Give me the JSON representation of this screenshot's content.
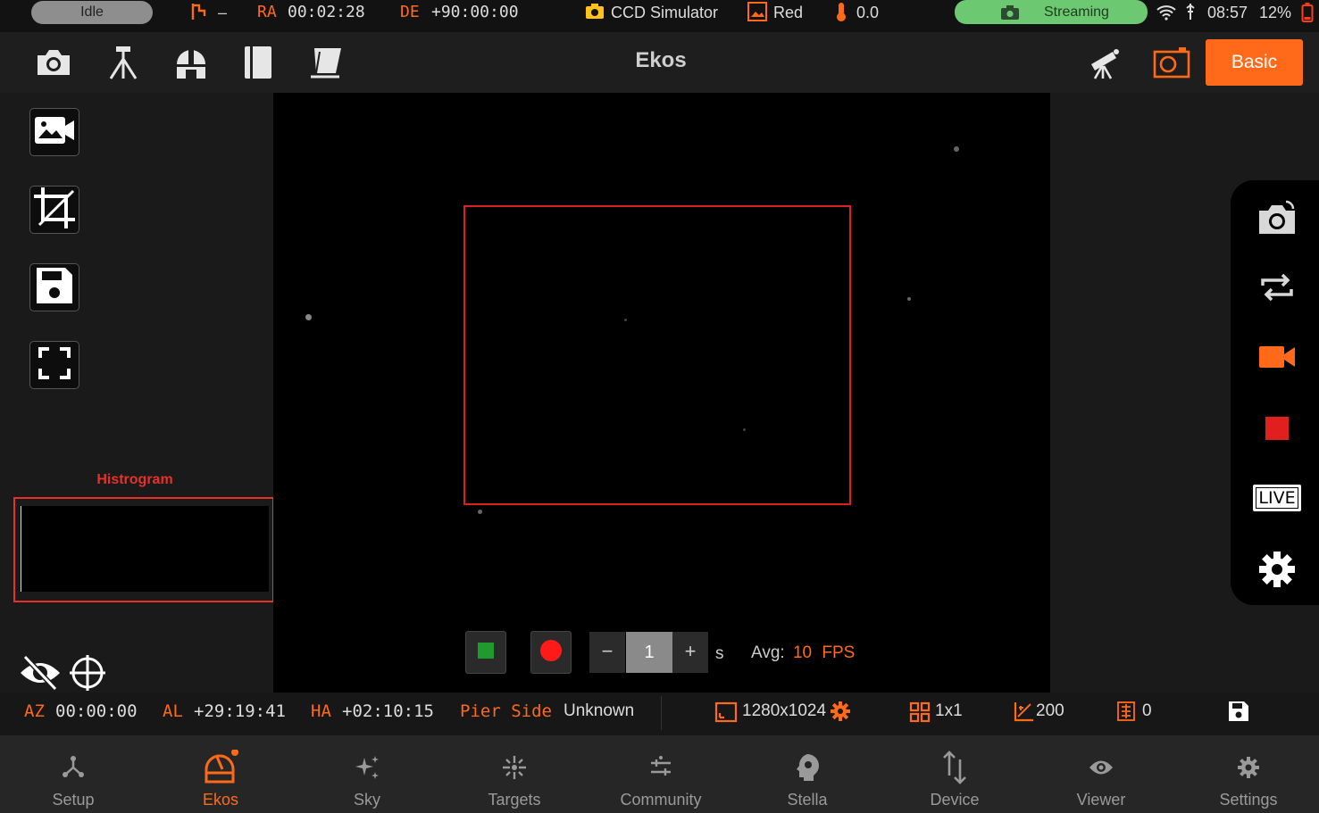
{
  "status_bar": {
    "state": "Idle",
    "mount_icon": "mount-icon",
    "mount_dash": "–",
    "ra_label": "RA",
    "ra_value": "00:02:28",
    "de_label": "DE",
    "de_value": "+90:00:00",
    "camera_name": "CCD Simulator",
    "filter_name": "Red",
    "temperature": "0.0",
    "streaming_label": "Streaming",
    "time": "08:57",
    "battery": "12%"
  },
  "toolbar": {
    "title": "Ekos",
    "basic_button": "Basic",
    "icons": [
      "camera-icon",
      "tripod-icon",
      "dome-icon",
      "notebook-icon",
      "flat-panel-icon",
      "telescope-icon",
      "frame-capture-icon"
    ]
  },
  "left_panel": {
    "buttons": [
      "video-camera-icon",
      "crop-icon",
      "save-icon",
      "fullscreen-icon"
    ],
    "histogram_label": "Histrogram"
  },
  "capture": {
    "exposure_value": "1",
    "exposure_unit": "s",
    "minus": "−",
    "plus": "+",
    "avg_label": "Avg:",
    "fps_value": "10",
    "fps_label": "FPS"
  },
  "right_rail": {
    "icons": [
      "camera-switch-icon",
      "loop-icon",
      "video-record-icon",
      "stop-icon",
      "live-icon",
      "settings-icon"
    ],
    "live_label": "LIVE"
  },
  "info_bar": {
    "az_label": "AZ",
    "az_value": "00:00:00",
    "al_label": "AL",
    "al_value": "+29:19:41",
    "ha_label": "HA",
    "ha_value": "+02:10:15",
    "pier_label": "Pier Side",
    "pier_value": "Unknown",
    "resolution": "1280x1024",
    "binning": "1x1",
    "gain": "200",
    "offset": "0"
  },
  "bottom_nav": {
    "items": [
      {
        "label": "Setup",
        "icon": "setup-icon"
      },
      {
        "label": "Ekos",
        "icon": "ekos-icon"
      },
      {
        "label": "Sky",
        "icon": "sky-icon"
      },
      {
        "label": "Targets",
        "icon": "targets-icon"
      },
      {
        "label": "Community",
        "icon": "community-icon"
      },
      {
        "label": "Stella",
        "icon": "stella-icon"
      },
      {
        "label": "Device",
        "icon": "device-icon"
      },
      {
        "label": "Viewer",
        "icon": "viewer-icon"
      },
      {
        "label": "Settings",
        "icon": "settings-icon"
      }
    ],
    "active": "Ekos"
  },
  "colors": {
    "accent": "#ff6a1a",
    "roi_border": "#e01f1f",
    "streaming_pill": "#6dc872",
    "stop_button": "#1f9a2e",
    "record_button": "#ff1a1a"
  }
}
